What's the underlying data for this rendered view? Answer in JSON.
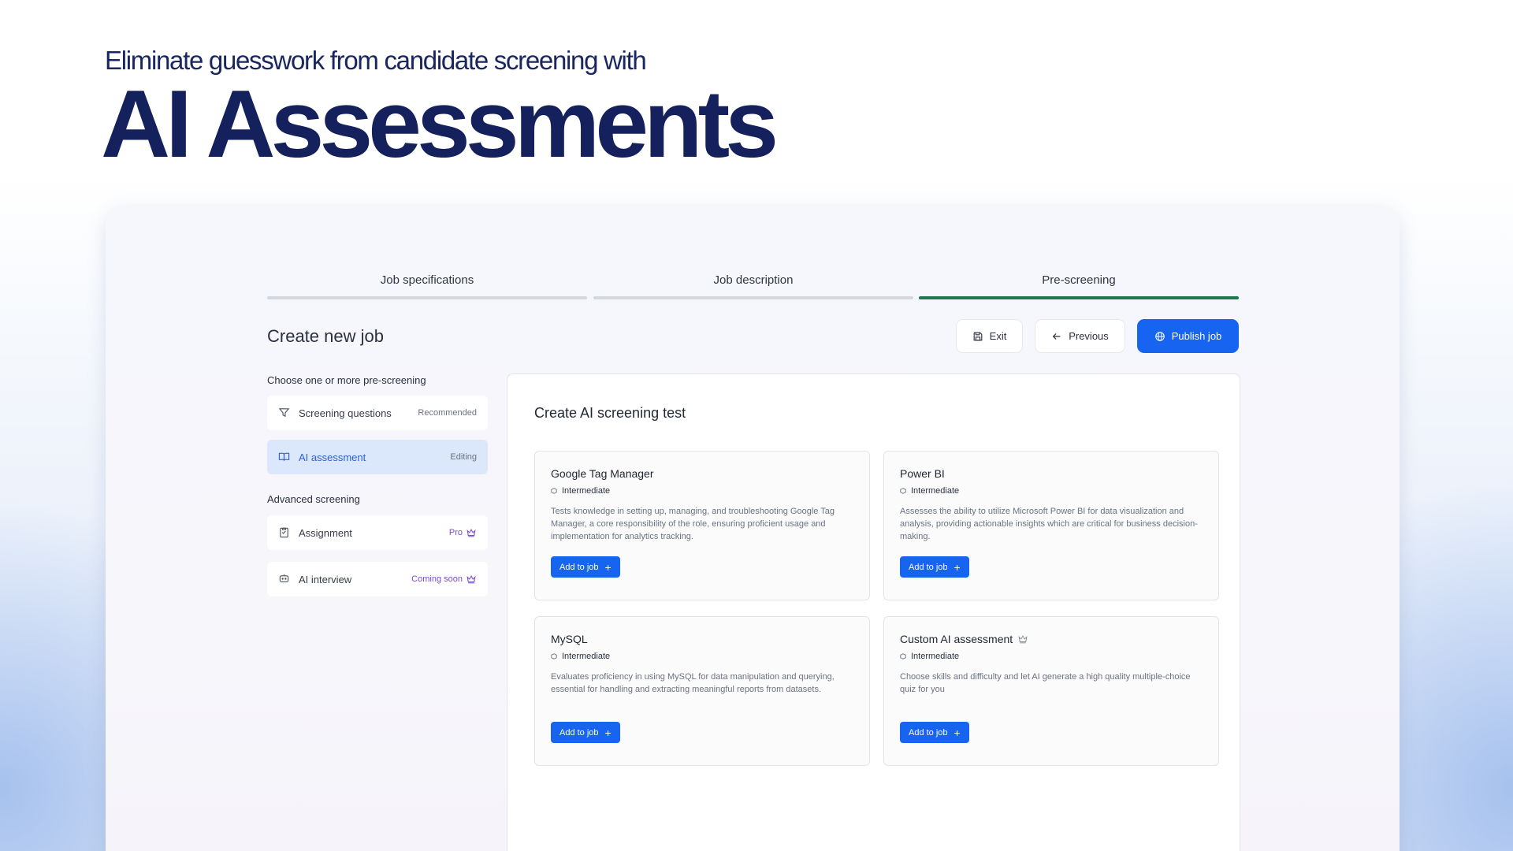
{
  "hero": {
    "subtitle": "Eliminate guesswork from candidate screening with",
    "title": "AI Assessments"
  },
  "stepper": {
    "steps": [
      {
        "label": "Job specifications",
        "active": false
      },
      {
        "label": "Job description",
        "active": false
      },
      {
        "label": "Pre-screening",
        "active": true
      }
    ]
  },
  "header": {
    "title": "Create new job",
    "exit_label": "Exit",
    "previous_label": "Previous",
    "publish_label": "Publish job"
  },
  "sidebar": {
    "prescreen_heading": "Choose one or more pre-screening",
    "prescreen_items": [
      {
        "label": "Screening questions",
        "tag": "Recommended",
        "icon": "filter-icon"
      },
      {
        "label": "AI assessment",
        "tag": "Editing",
        "icon": "book-icon",
        "active": true
      }
    ],
    "advanced_heading": "Advanced screening",
    "advanced_items": [
      {
        "label": "Assignment",
        "tag": "Pro",
        "icon": "clipboard-icon"
      },
      {
        "label": "AI interview",
        "tag": "Coming soon",
        "icon": "chat-bot-icon"
      }
    ]
  },
  "main": {
    "title": "Create AI screening test",
    "cards": [
      {
        "title": "Google Tag Manager",
        "level": "Intermediate",
        "description": "Tests knowledge in setting up, managing, and troubleshooting Google Tag Manager, a core responsibility of the role, ensuring proficient usage and implementation for analytics tracking.",
        "button": "Add to job"
      },
      {
        "title": "Power BI",
        "level": "Intermediate",
        "description": "Assesses the ability to utilize Microsoft Power BI for data visualization and analysis, providing actionable insights which are critical for business decision-making.",
        "button": "Add to job"
      },
      {
        "title": "MySQL",
        "level": "Intermediate",
        "description": "Evaluates proficiency in using MySQL for data manipulation and querying, essential for handling and extracting meaningful reports from datasets.",
        "button": "Add to job"
      },
      {
        "title": "Custom AI assessment",
        "level": "Intermediate",
        "description": "Choose skills and difficulty and let AI generate a high quality multiple-choice quiz for you",
        "button": "Add to job"
      }
    ]
  },
  "colors": {
    "primary": "#1764f0",
    "step_active": "#1a7a4c",
    "hero_text": "#15215c",
    "pro_accent": "#7a4dd0"
  }
}
